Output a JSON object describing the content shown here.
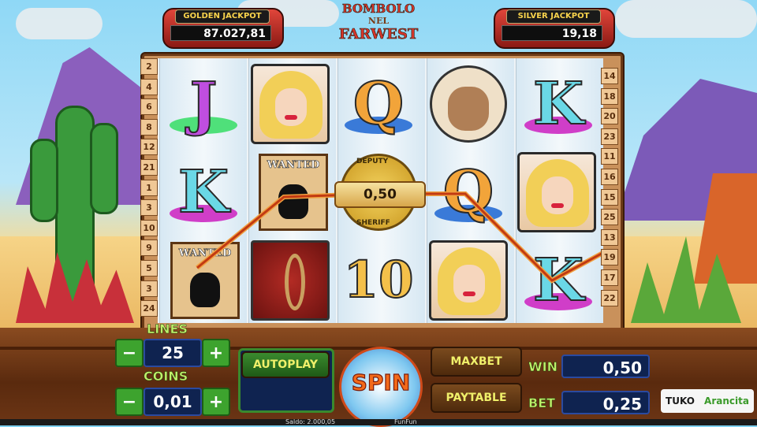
{
  "jackpots": {
    "golden": {
      "label": "GOLDEN JACKPOT",
      "value": "87.027,81"
    },
    "silver": {
      "label": "SILVER JACKPOT",
      "value": "19,18"
    }
  },
  "logo": {
    "line1": "BOMBOLO",
    "line2": "NEL",
    "line3": "FARWEST"
  },
  "paylines": {
    "left": [
      "2",
      "4",
      "6",
      "8",
      "12",
      "21",
      "1",
      "3",
      "10",
      "9",
      "5",
      "3",
      "24"
    ],
    "right": [
      "14",
      "18",
      "20",
      "23",
      "11",
      "16",
      "15",
      "25",
      "13",
      "19",
      "17",
      "22"
    ]
  },
  "reels": [
    [
      "J",
      "K",
      "WANTED"
    ],
    [
      "LADY",
      "WANTED",
      "NOOSE"
    ],
    [
      "Q",
      "SHERIFF",
      "10"
    ],
    [
      "CHIEF",
      "Q",
      "LADY"
    ],
    [
      "K",
      "LADY",
      "K"
    ]
  ],
  "symbol_texts": {
    "wanted": "WANTED",
    "sheriff_top": "DEPUTY",
    "sheriff_bottom": "SHERIFF"
  },
  "win_line_value": "0,50",
  "controls": {
    "lines_label": "LINES",
    "lines_value": "25",
    "coins_label": "COINS",
    "coins_value": "0,01",
    "minus": "−",
    "plus": "+",
    "autoplay": "AUTOPLAY",
    "spin": "SPIN",
    "maxbet": "MAXBET",
    "paytable": "PAYTABLE",
    "win_label": "WIN",
    "win_value": "0,50",
    "bet_label": "BET",
    "bet_value": "0,25"
  },
  "brand": {
    "left": "TUKO",
    "right": "Arancita"
  },
  "status": {
    "saldo": "Saldo: 2.000,05",
    "other": "FunFun"
  },
  "colors": {
    "payline": "#c23a12",
    "accent_green": "#3da32e",
    "navy": "#0f2350"
  }
}
